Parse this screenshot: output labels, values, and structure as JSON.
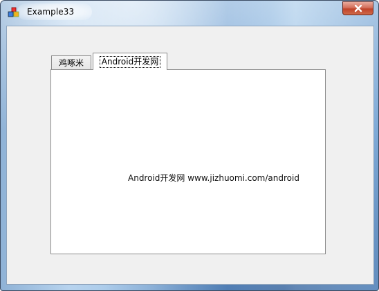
{
  "window": {
    "title": "Example33",
    "app_icon": "app-icon",
    "close_icon": "close-icon"
  },
  "tabs": [
    {
      "label": "鸡啄米",
      "selected": false
    },
    {
      "label": "Android开发网",
      "selected": true
    }
  ],
  "panel": {
    "text": "Android开发网 www.jizhuomi.com/android"
  }
}
